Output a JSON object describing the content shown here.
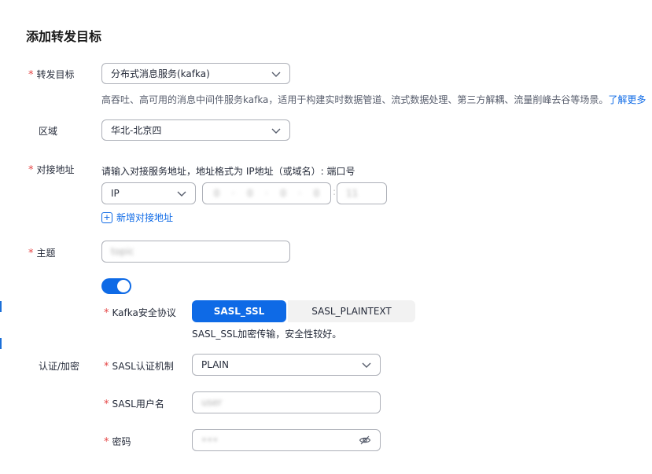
{
  "title": "添加转发目标",
  "forward_target": {
    "label": "转发目标",
    "value": "分布式消息服务(kafka)",
    "desc": "高吞吐、高可用的消息中间件服务kafka，适用于构建实时数据管道、流式数据处理、第三方解耦、流量削峰去谷等场景。",
    "more_link": "了解更多"
  },
  "region": {
    "label": "区域",
    "value": "华北-北京四"
  },
  "endpoint": {
    "label": "对接地址",
    "hint": "请输入对接服务地址，地址格式为 IP地址（或域名）: 端口号",
    "type_value": "IP",
    "ip_octets": [
      "0",
      "0",
      "0",
      "0"
    ],
    "port": "11",
    "sep_colon": ":",
    "add_label": "新增对接地址",
    "add_icon": "+"
  },
  "topic": {
    "label": "主题",
    "value": "topic"
  },
  "auth": {
    "enabled": true,
    "section_label": "认证/加密",
    "protocol": {
      "label": "Kafka安全协议",
      "options": [
        "SASL_SSL",
        "SASL_PLAINTEXT"
      ],
      "selected": "SASL_SSL",
      "desc": "SASL_SSL加密传输，安全性较好。"
    },
    "mechanism": {
      "label": "SASL认证机制",
      "value": "PLAIN"
    },
    "username": {
      "label": "SASL用户名",
      "value": "user"
    },
    "password": {
      "label": "密码",
      "value": "•••"
    }
  },
  "colors": {
    "accent": "#0e6ae6",
    "required": "#e54545"
  }
}
